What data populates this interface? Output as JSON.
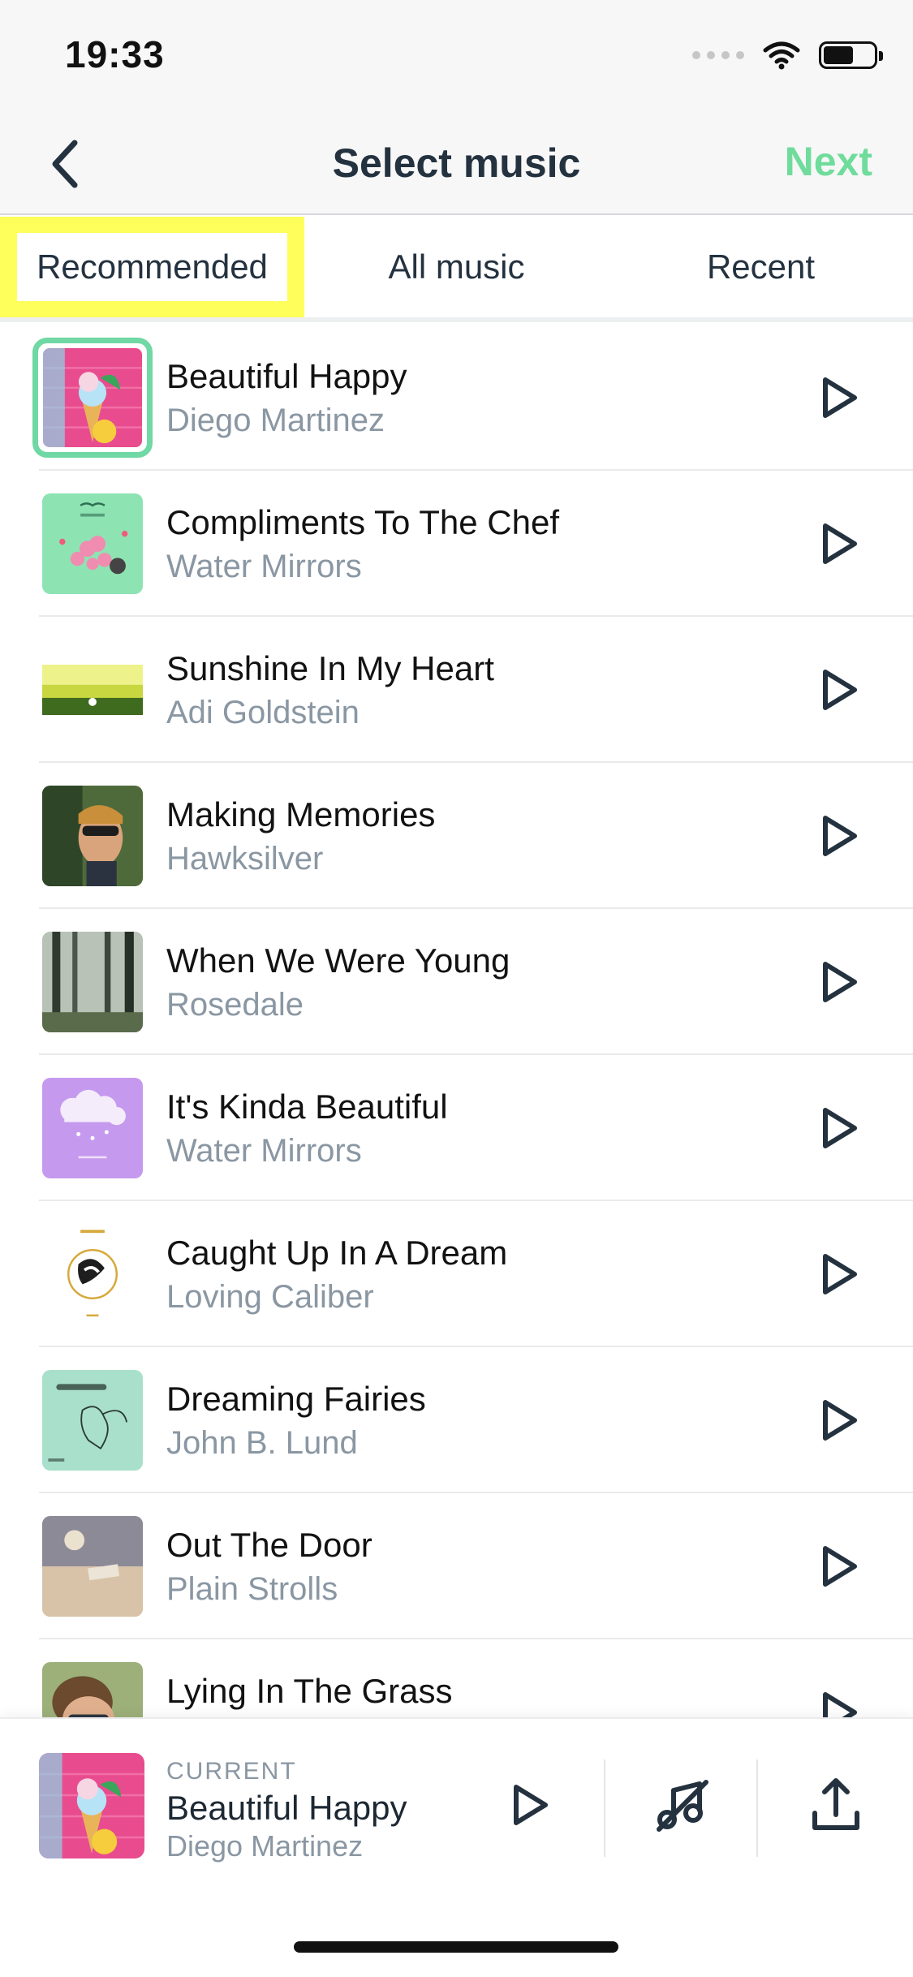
{
  "status_bar": {
    "time": "19:33"
  },
  "nav": {
    "title": "Select music",
    "next_label": "Next"
  },
  "tabs": [
    {
      "label": "Recommended",
      "highlighted": true
    },
    {
      "label": "All music",
      "highlighted": false
    },
    {
      "label": "Recent",
      "highlighted": false
    }
  ],
  "tracks": [
    {
      "title": "Beautiful Happy",
      "artist": "Diego Martinez",
      "selected": true,
      "art": "pink-brick-icecream"
    },
    {
      "title": "Compliments To The Chef",
      "artist": "Water Mirrors",
      "selected": false,
      "art": "mint-balloon-dog"
    },
    {
      "title": "Sunshine In My Heart",
      "artist": "Adi Goldstein",
      "selected": false,
      "art": "sunlit-meadow"
    },
    {
      "title": "Making Memories",
      "artist": "Hawksilver",
      "selected": false,
      "art": "man-sunglasses"
    },
    {
      "title": "When We Were Young",
      "artist": "Rosedale",
      "selected": false,
      "art": "misty-forest"
    },
    {
      "title": "It's Kinda Beautiful",
      "artist": "Water Mirrors",
      "selected": false,
      "art": "purple-clouds"
    },
    {
      "title": "Caught Up In A Dream",
      "artist": "Loving Caliber",
      "selected": false,
      "art": "white-swirl"
    },
    {
      "title": "Dreaming Fairies",
      "artist": "John B. Lund",
      "selected": false,
      "art": "mint-fairy-sketch"
    },
    {
      "title": "Out The Door",
      "artist": "Plain Strolls",
      "selected": false,
      "art": "hazy-sky"
    },
    {
      "title": "Lying In The Grass",
      "artist": "",
      "selected": false,
      "art": "person-in-grass"
    }
  ],
  "player": {
    "current_label": "CURRENT",
    "title": "Beautiful Happy",
    "artist": "Diego Martinez"
  },
  "colors": {
    "accent": "#6fdc9c",
    "highlight": "#ffff5c",
    "title_text": "#243240",
    "secondary_text": "#8a97a3"
  },
  "icons": [
    "back-chevron-icon",
    "play-icon",
    "music-off-icon",
    "share-icon",
    "wifi-icon",
    "battery-icon"
  ]
}
